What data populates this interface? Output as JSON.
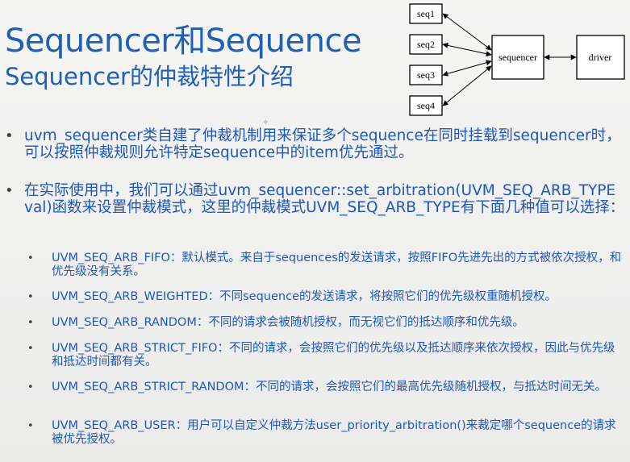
{
  "title": {
    "line1": "Sequencer和Sequence",
    "line2": "Sequencer的仲裁特性介绍"
  },
  "diagram": {
    "seqs": [
      "seq1",
      "seq2",
      "seq3",
      "seq4"
    ],
    "sequencer": "sequencer",
    "driver": "driver"
  },
  "bullets": [
    "uvm_sequencer类自建了仲裁机制用来保证多个sequence在同时挂载到sequencer时，可以按照仲裁规则允许特定sequence中的item优先通过。",
    "在实际使用中，我们可以通过uvm_sequencer::set_arbitration(UVM_SEQ_ARB_TYPE val)函数来设置仲裁模式，这里的仲裁模式UVM_SEQ_ARB_TYPE有下面几种值可以选择："
  ],
  "sub_bullets": [
    "UVM_SEQ_ARB_FIFO：默认模式。来自于sequences的发送请求，按照FIFO先进先出的方式被依次授权，和优先级没有关系。",
    "UVM_SEQ_ARB_WEIGHTED：不同sequence的发送请求，将按照它们的优先级权重随机授权。",
    "UVM_SEQ_ARB_RANDOM：不同的请求会被随机授权，而无视它们的抵达顺序和优先级。",
    "UVM_SEQ_ARB_STRICT_FIFO：不同的请求，会按照它们的优先级以及抵达顺序来依次授权，因此与优先级和抵达时间都有关。",
    "UVM_SEQ_ARB_STRICT_RANDOM：不同的请求，会按照它们的最高优先级随机授权，与抵达时间无关。",
    "UVM_SEQ_ARB_USER：用户可以自定义仲裁方法user_priority_arbitration()来裁定哪个sequence的请求被优先授权。"
  ]
}
